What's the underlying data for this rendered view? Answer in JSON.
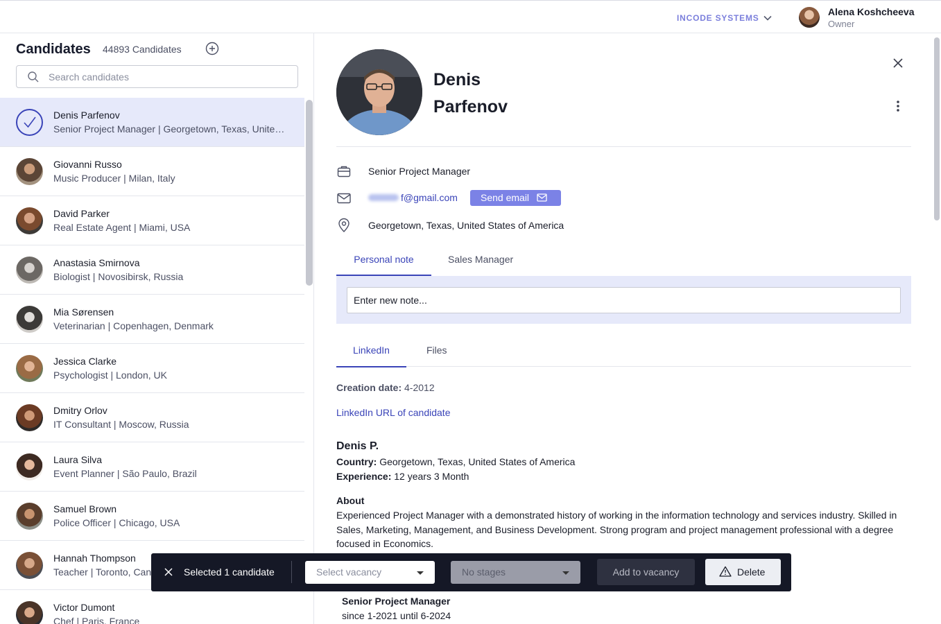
{
  "topbar": {
    "org_name": "INCODE SYSTEMS",
    "user_name": "Alena Koshcheeva",
    "user_role": "Owner"
  },
  "candidates": {
    "title": "Candidates",
    "count_label": "44893 Candidates",
    "search_placeholder": "Search candidates",
    "items": [
      {
        "name": "Denis Parfenov",
        "subtitle": "Senior Project Manager | Georgetown, Texas, United States of America",
        "selected": true
      },
      {
        "name": "Giovanni Russo",
        "subtitle": "Music Producer | Milan, Italy"
      },
      {
        "name": "David Parker",
        "subtitle": "Real Estate Agent | Miami, USA"
      },
      {
        "name": "Anastasia Smirnova",
        "subtitle": "Biologist | Novosibirsk, Russia"
      },
      {
        "name": "Mia Sørensen",
        "subtitle": "Veterinarian | Copenhagen, Denmark"
      },
      {
        "name": "Jessica Clarke",
        "subtitle": "Psychologist | London, UK"
      },
      {
        "name": "Dmitry Orlov",
        "subtitle": "IT Consultant | Moscow, Russia"
      },
      {
        "name": "Laura Silva",
        "subtitle": "Event Planner | São Paulo, Brazil"
      },
      {
        "name": "Samuel Brown",
        "subtitle": "Police Officer | Chicago, USA"
      },
      {
        "name": "Hannah Thompson",
        "subtitle": "Teacher | Toronto, Canada"
      },
      {
        "name": "Victor Dumont",
        "subtitle": "Chef | Paris, France"
      }
    ]
  },
  "profile": {
    "first_name": "Denis",
    "last_name": "Parfenov",
    "position": "Senior Project Manager",
    "email_visible": "f@gmail.com",
    "send_email_label": "Send email",
    "location": "Georgetown, Texas, United States of America",
    "note_tabs": [
      "Personal note",
      "Sales Manager"
    ],
    "note_placeholder": "Enter new note...",
    "info_tabs": [
      "LinkedIn",
      "Files"
    ],
    "creation_label": "Creation date:",
    "creation_value": "4-2012",
    "linkedin_link": "LinkedIn URL of candidate",
    "short_name": "Denis P.",
    "country_label": "Country:",
    "country_value": "Georgetown, Texas, United States of America",
    "experience_label": "Experience:",
    "experience_value": "12 years 3 Month",
    "about_heading": "About",
    "about_text": "Experienced Project Manager with a demonstrated history of working in the information technology and services industry. Skilled in Sales, Marketing, Management, and Business Development. Strong program and project management professional with a degree focused in Economics.",
    "job_title": "Senior Project Manager",
    "job_period": "since 1-2021 until 6-2024"
  },
  "action_bar": {
    "selected_text": "Selected 1 candidate",
    "vacancy_placeholder": "Select vacancy",
    "stages_placeholder": "No stages",
    "add_label": "Add to vacancy",
    "delete_label": "Delete"
  },
  "colors": {
    "accent": "#3a44b8",
    "accent_light": "#7b82e6",
    "selected_row_bg": "#e6e9fa",
    "action_bar_bg": "#151826"
  }
}
